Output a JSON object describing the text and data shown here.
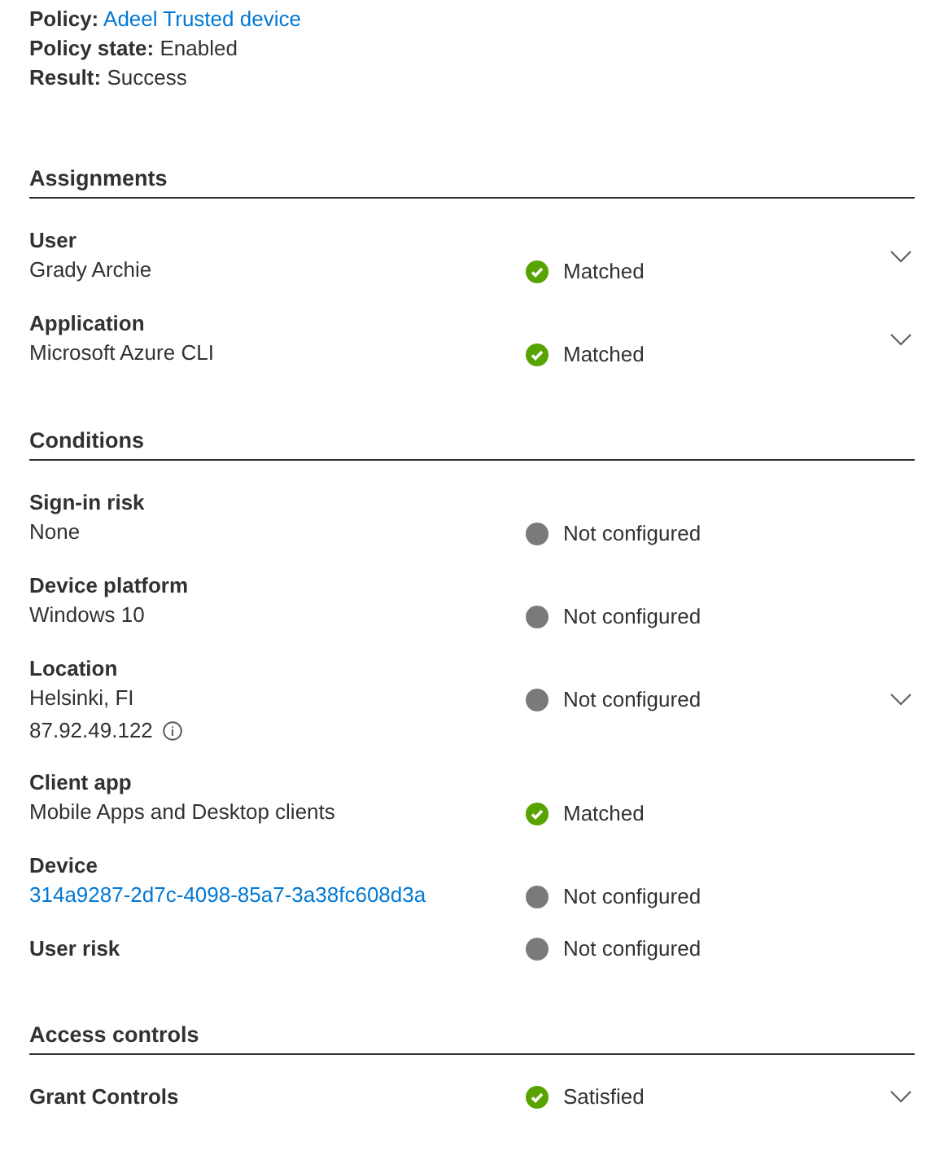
{
  "summary": [
    {
      "label": "Policy:",
      "value": "Adeel Trusted device",
      "kind": "link"
    },
    {
      "label": "Policy state:",
      "value": "Enabled",
      "kind": "text"
    },
    {
      "label": "Result:",
      "value": "Success",
      "kind": "text"
    }
  ],
  "sections": [
    {
      "title": "Assignments",
      "rows": [
        {
          "label": "User",
          "values": [
            {
              "text": "Grady Archie",
              "kind": "text",
              "info": false
            }
          ],
          "status": "Matched",
          "kind": "success",
          "expandable": true
        },
        {
          "label": "Application",
          "values": [
            {
              "text": "Microsoft Azure CLI",
              "kind": "text",
              "info": false
            }
          ],
          "status": "Matched",
          "kind": "success",
          "expandable": true
        }
      ]
    },
    {
      "title": "Conditions",
      "rows": [
        {
          "label": "Sign-in risk",
          "values": [
            {
              "text": "None",
              "kind": "text",
              "info": false
            }
          ],
          "status": "Not configured",
          "kind": "neutral",
          "expandable": false
        },
        {
          "label": "Device platform",
          "values": [
            {
              "text": "Windows 10",
              "kind": "text",
              "info": false
            }
          ],
          "status": "Not configured",
          "kind": "neutral",
          "expandable": false
        },
        {
          "label": "Location",
          "values": [
            {
              "text": "Helsinki, FI",
              "kind": "text",
              "info": false
            },
            {
              "text": "87.92.49.122",
              "kind": "text",
              "info": true
            }
          ],
          "status": "Not configured",
          "kind": "neutral",
          "expandable": true
        },
        {
          "label": "Client app",
          "values": [
            {
              "text": "Mobile Apps and Desktop clients",
              "kind": "text",
              "info": false
            }
          ],
          "status": "Matched",
          "kind": "success",
          "expandable": false
        },
        {
          "label": "Device",
          "values": [
            {
              "text": "314a9287-2d7c-4098-85a7-3a38fc608d3a",
              "kind": "link",
              "info": false
            }
          ],
          "status": "Not configured",
          "kind": "neutral",
          "expandable": false
        },
        {
          "label": "User risk",
          "values": [],
          "status": "Not configured",
          "kind": "neutral",
          "expandable": false
        }
      ]
    },
    {
      "title": "Access controls",
      "rows": [
        {
          "label": "Grant Controls",
          "values": [],
          "status": "Satisfied",
          "kind": "success",
          "expandable": true
        }
      ]
    }
  ]
}
